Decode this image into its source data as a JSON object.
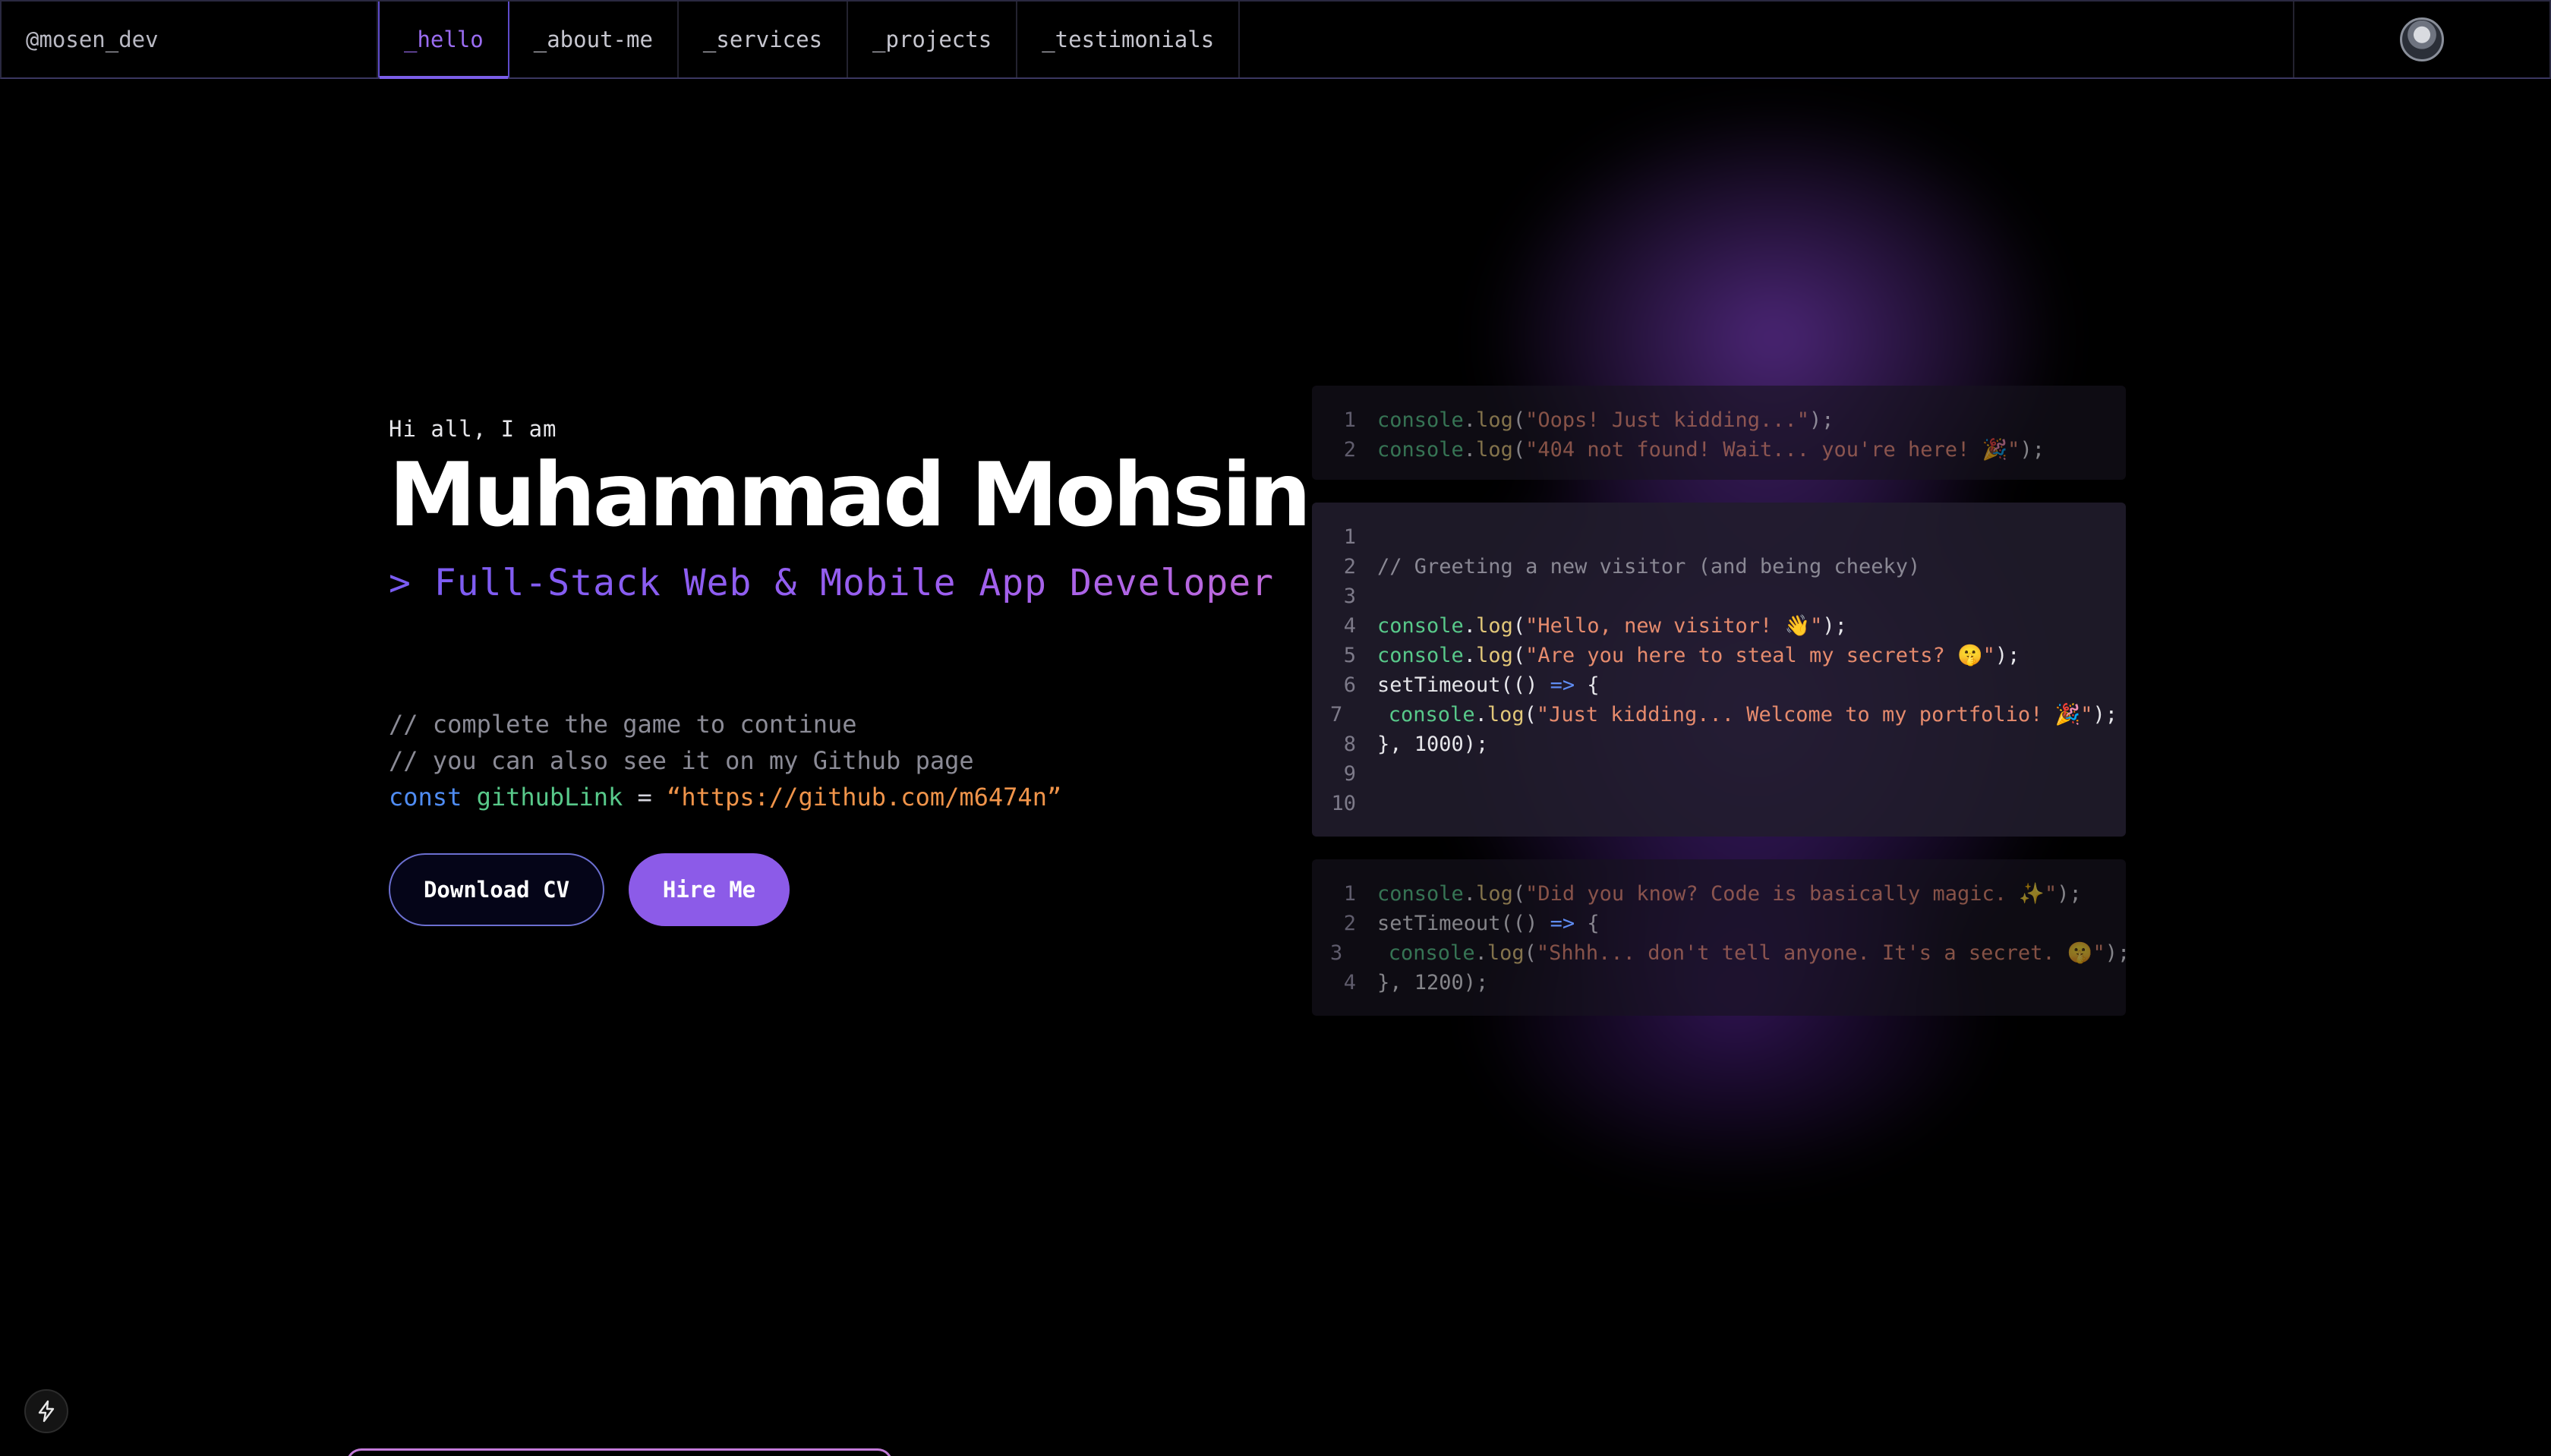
{
  "nav": {
    "brand": "@mosen_dev",
    "tabs": [
      {
        "label": "_hello",
        "active": true
      },
      {
        "label": "_about-me",
        "active": false
      },
      {
        "label": "_services",
        "active": false
      },
      {
        "label": "_projects",
        "active": false
      },
      {
        "label": "_testimonials",
        "active": false
      }
    ]
  },
  "hero": {
    "greeting": "Hi all, I am",
    "name": "Muhammad Mohsin",
    "role": "> Full-Stack Web & Mobile App Developer",
    "comment1": "// complete the game to continue",
    "comment2": "// you can also see it on my Github page",
    "code": {
      "keyword": "const",
      "var": "githubLink",
      "op": "=",
      "value": "“https://github.com/m6474n”"
    },
    "download_label": "Download CV",
    "hire_label": "Hire Me"
  },
  "cards": {
    "card1": [
      {
        "n": "1",
        "code": "console.log(\"Oops! Just kidding...\");"
      },
      {
        "n": "2",
        "code": "console.log(\"404 not found! Wait... you're here! 🎉\");"
      }
    ],
    "card2": [
      {
        "n": "1",
        "code": ""
      },
      {
        "n": "2",
        "code": "// Greeting a new visitor (and being cheeky)"
      },
      {
        "n": "3",
        "code": ""
      },
      {
        "n": "4",
        "code": "console.log(\"Hello, new visitor! 👋\");"
      },
      {
        "n": "5",
        "code": "console.log(\"Are you here to steal my secrets? 🤫\");"
      },
      {
        "n": "6",
        "code": "setTimeout(() => {"
      },
      {
        "n": "7",
        "code": "  console.log(\"Just kidding... Welcome to my portfolio! 🎉\");"
      },
      {
        "n": "8",
        "code": "}, 1000);"
      },
      {
        "n": "9",
        "code": ""
      },
      {
        "n": "10",
        "code": ""
      }
    ],
    "card3": [
      {
        "n": "1",
        "code": "console.log(\"Did you know? Code is basically magic. ✨\");"
      },
      {
        "n": "2",
        "code": "setTimeout(() => {"
      },
      {
        "n": "3",
        "code": "  console.log(\"Shhh... don't tell anyone. It's a secret. 🤫\");"
      },
      {
        "n": "4",
        "code": "}, 1200);"
      }
    ]
  },
  "icons": {
    "avatar": "avatar-image",
    "bolt": "lightning-icon"
  },
  "colors": {
    "accent": "#8c5be8",
    "tab_active": "#9a6cf0",
    "keyword": "#4f8cf2",
    "variable": "#58c98a",
    "string": "#f0944a"
  }
}
